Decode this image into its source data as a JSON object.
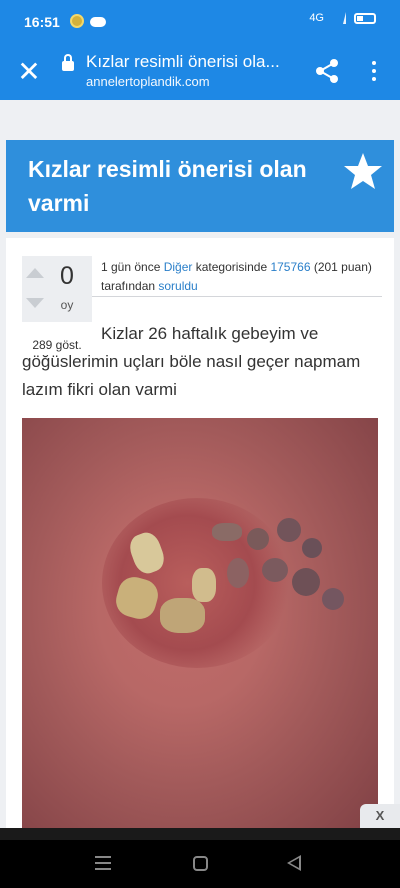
{
  "status_bar": {
    "time": "16:51",
    "network": "4G"
  },
  "browser": {
    "close_label": "✕",
    "tab_title": "Kızlar resimli önerisi ola...",
    "url": "annelertoplandik.com"
  },
  "question": {
    "title": "Kızlar resimli önerisi olan varmi",
    "votes": "0",
    "vote_unit": "oy",
    "views": "289 göst.",
    "meta_prefix": "1 gün önce ",
    "category": "Diğer",
    "meta_category_suffix": " kategorisinde ",
    "user": "175766",
    "user_points": " (201 puan) tarafından ",
    "action": "soruldu",
    "body": "Kizlar 26 haftalık gebeyim ve göğüslerimin uçları böle nasıl geçer napmam lazım fikri olan varmi"
  },
  "ad": {
    "close_label": "X"
  },
  "colors": {
    "brand_blue": "#1e88e5",
    "title_banner": "#2f8fdc",
    "link": "#2a7fc9"
  },
  "icons": [
    "close-icon",
    "lock-icon",
    "share-icon",
    "more-vert-icon",
    "star-icon",
    "vote-up-icon",
    "vote-down-icon",
    "nav-menu-icon",
    "nav-home-icon",
    "nav-back-icon"
  ]
}
